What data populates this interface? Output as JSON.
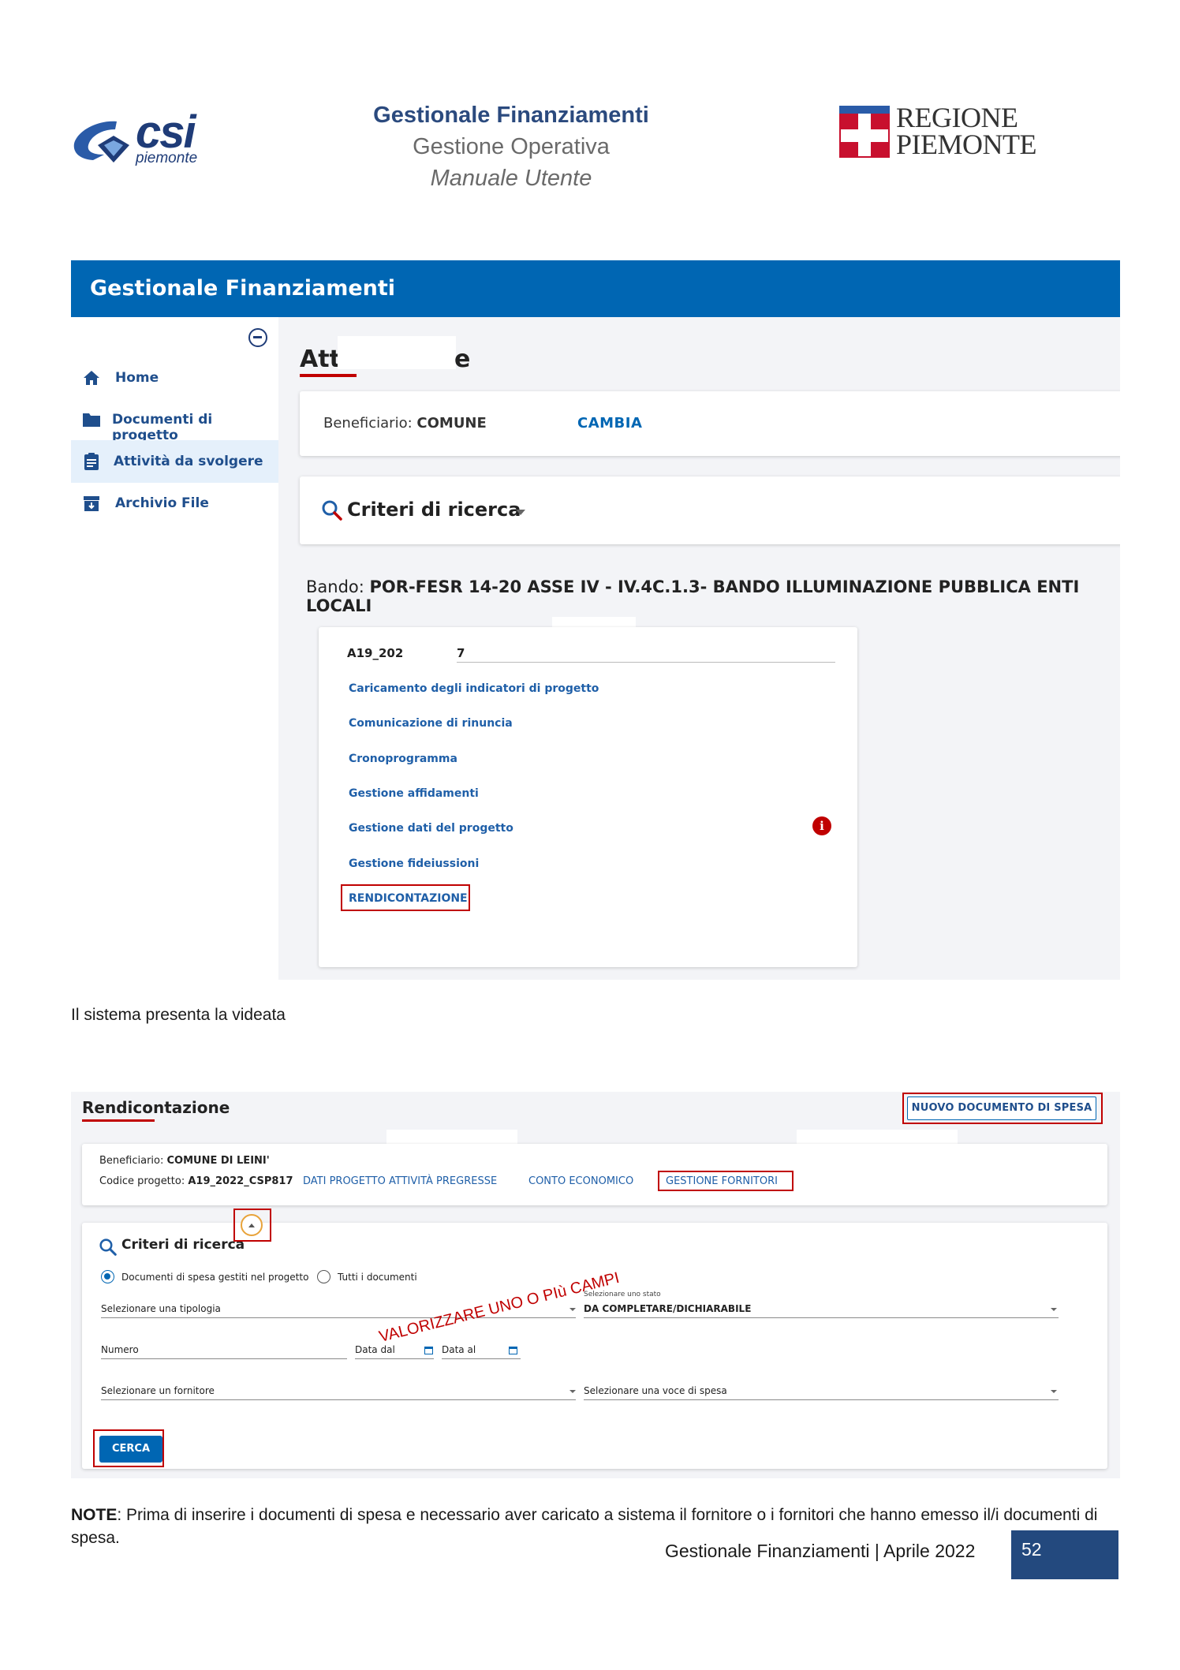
{
  "header": {
    "csi_logo": "csi",
    "csi_logo_sub": "piemonte",
    "title": "Gestionale Finanziamenti",
    "subtitle": "Gestione Operativa",
    "manual": "Manuale Utente",
    "region_logo_line1": "REGIONE",
    "region_logo_line2": "PIEMONTE"
  },
  "screen1": {
    "app_title": "Gestionale Finanziamenti",
    "sidebar": {
      "items": [
        {
          "label": "Home",
          "icon": "home-icon"
        },
        {
          "label": "Documenti di progetto",
          "icon": "folder-icon"
        },
        {
          "label": "Attività da svolgere",
          "icon": "clipboard-icon",
          "active": true
        },
        {
          "label": "Archivio File",
          "icon": "archive-icon"
        }
      ]
    },
    "page_title_start": "Att",
    "page_title_end": "e",
    "beneficiary_label": "Beneficiario:",
    "beneficiary_value": "COMUNE",
    "change_button": "CAMBIA",
    "search_title": "Criteri di ricerca",
    "bando_label": "Bando:",
    "bando_value": "POR-FESR 14-20 ASSE IV - IV.4C.1.3- BANDO ILLUMINAZIONE PUBBLICA ENTI LOCALI",
    "project_code_start": "A19_2021",
    "project_code_end": "7",
    "activities": [
      "Caricamento degli indicatori di progetto",
      "Comunicazione di rinuncia",
      "Cronoprogramma",
      "Gestione affidamenti",
      "Gestione dati del progetto",
      "Gestione fideiussioni",
      "RENDICONTAZIONE"
    ],
    "info_icon": "i"
  },
  "body_text": "Il sistema presenta la videata",
  "screen2": {
    "title": "Rendicontazione",
    "new_document_button": "NUOVO DOCUMENTO DI SPESA",
    "beneficiary_label": "Beneficiario:",
    "beneficiary_value": "COMUNE DI LEINI'",
    "project_code_label": "Codice progetto:",
    "project_code_value": "A19_2022_CSP817",
    "links": [
      "DATI PROGETTO ATTIVITÀ PREGRESSE",
      "CONTO ECONOMICO",
      "GESTIONE FORNITORI"
    ],
    "search_title": "Criteri di ricerca",
    "radio_options": [
      "Documenti di spesa gestiti nel progetto",
      "Tutti i documenti"
    ],
    "radio_selected": 0,
    "type_placeholder": "Selezionare una tipologia",
    "state_label": "Selezionare uno stato",
    "state_value": "DA COMPLETARE/DICHIARABILE",
    "number_placeholder": "Numero",
    "date_from": "Data dal",
    "date_to": "Data al",
    "supplier_placeholder": "Selezionare un fornitore",
    "expense_placeholder": "Selezionare una voce di spesa",
    "annotation": "VALORIZZARE UNO O PIù CAMPI",
    "search_button": "CERCA"
  },
  "note": {
    "label": "NOTE",
    "text": ": Prima di inserire i documenti di spesa e necessario aver caricato a sistema il fornitore o i fornitori che hanno emesso il/i documenti di spesa."
  },
  "footer": {
    "text": "Gestionale Finanziamenti | Aprile 2022",
    "page_number": "52"
  },
  "colors": {
    "app_bar": "#0066b3",
    "highlight": "#c00000",
    "link": "#1f5fa8",
    "footer_box": "#23497e"
  }
}
